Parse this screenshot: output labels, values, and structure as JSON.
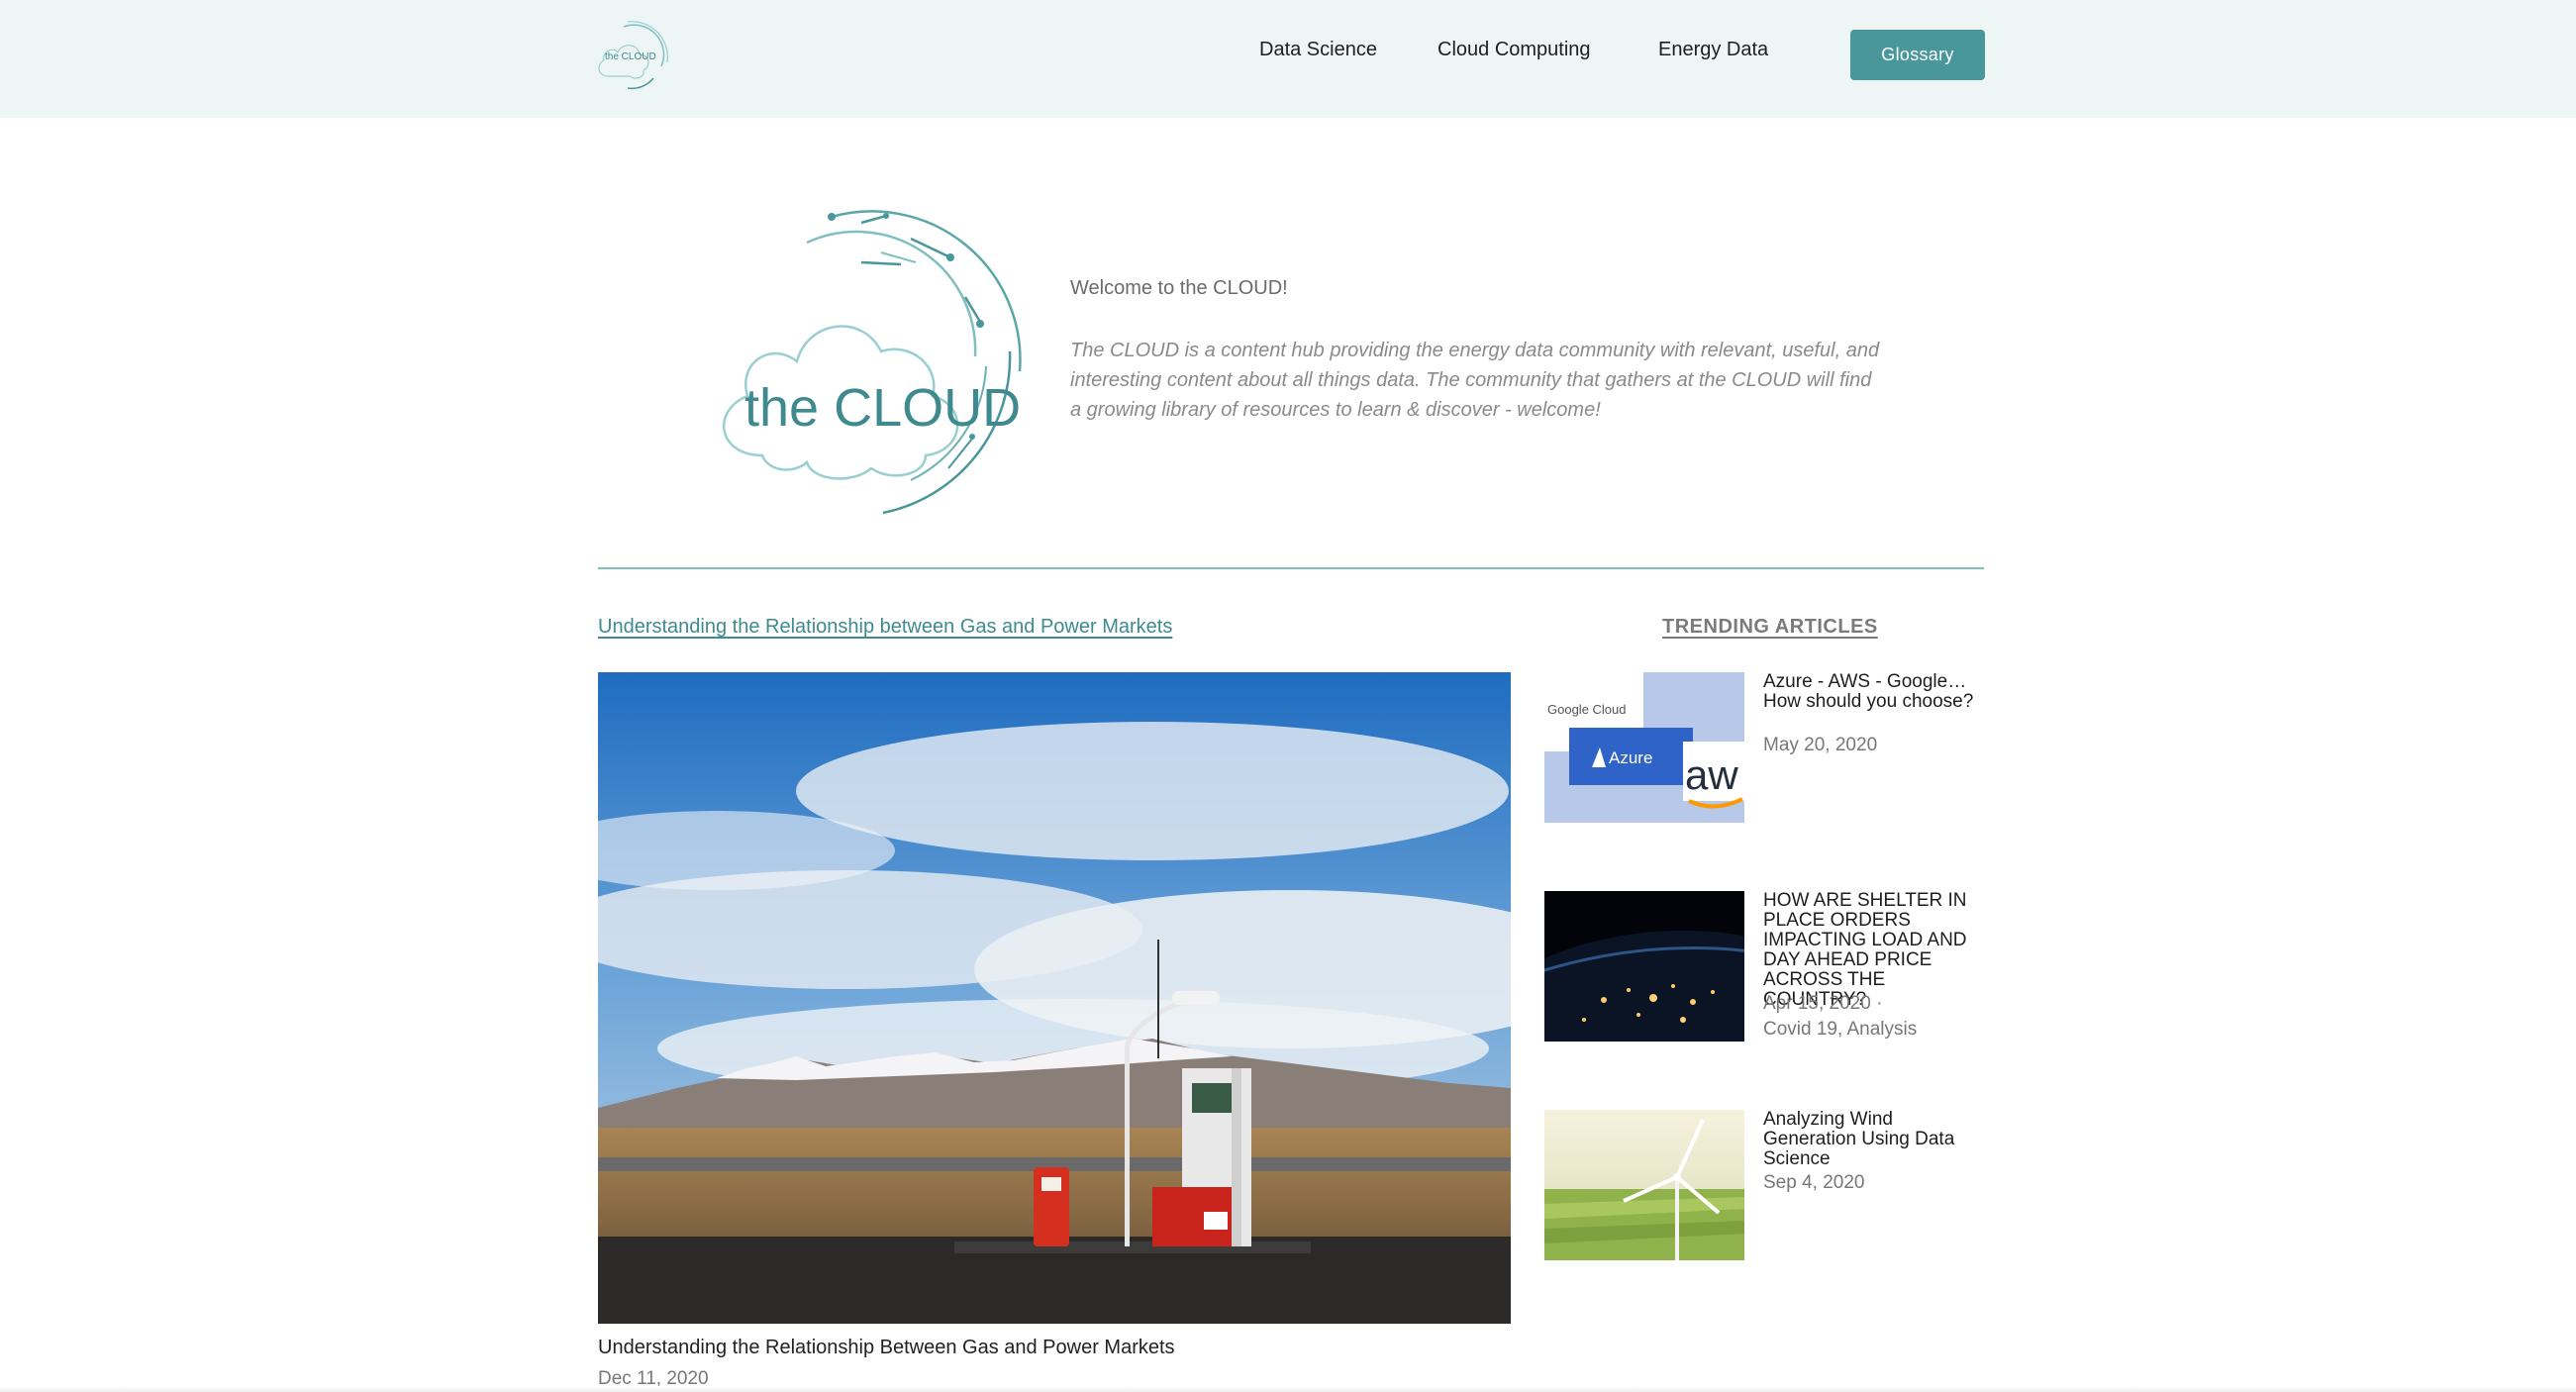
{
  "header": {
    "logo_text": "the CLOUD",
    "nav": [
      {
        "label": "Data Science"
      },
      {
        "label": "Cloud Computing"
      },
      {
        "label": "Energy Data"
      }
    ],
    "glossary_label": "Glossary"
  },
  "hero": {
    "logo_text": "the CLOUD",
    "welcome_title": "Welcome to the CLOUD!",
    "welcome_text": "The CLOUD is a content hub providing the energy data community with relevant, useful, and interesting content about all things data.  The community that gathers at the CLOUD will find a growing library of resources to learn & discover - welcome!"
  },
  "featured": {
    "link_text": "Understanding the Relationship between Gas and Power Markets",
    "caption": "Understanding the Relationship Between Gas and Power Markets",
    "date": "Dec 11, 2020"
  },
  "trending": {
    "heading": "TRENDING ARTICLES",
    "articles": [
      {
        "title": "Azure - AWS - Google… How should you choose?",
        "date": "May 20, 2020",
        "tags": "",
        "thumb_labels": {
          "google": "Google Cloud",
          "azure": "Azure",
          "aws": "aw"
        }
      },
      {
        "title": "HOW ARE SHELTER IN PLACE ORDERS IMPACTING LOAD AND DAY AHEAD PRICE ACROSS THE COUNTRY?",
        "date": "Apr 15, 2020  ·",
        "tags": "Covid 19, Analysis"
      },
      {
        "title": "Analyzing Wind Generation Using Data Science",
        "date": "Sep 4, 2020",
        "tags": ""
      }
    ]
  },
  "colors": {
    "accent": "#4a979b",
    "header_bg": "#eef5f5",
    "link": "#3e8a8e"
  }
}
